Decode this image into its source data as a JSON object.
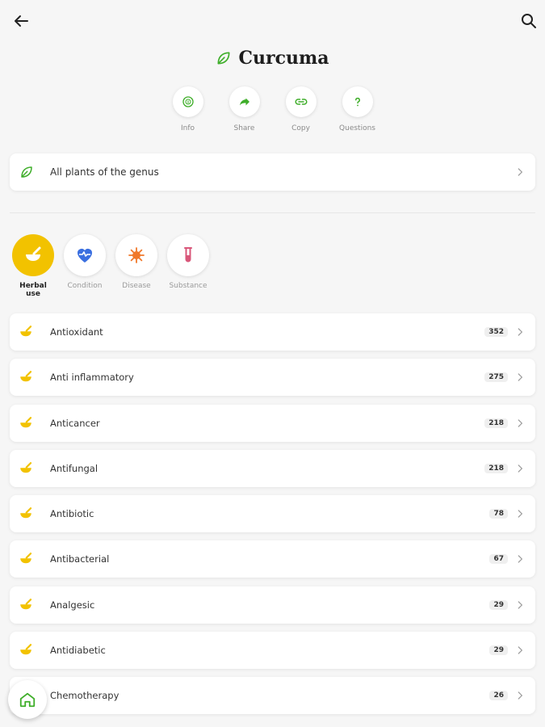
{
  "header": {
    "title": "Curcuma"
  },
  "actions": [
    {
      "label": "Info",
      "icon": "info-icon"
    },
    {
      "label": "Share",
      "icon": "share-icon"
    },
    {
      "label": "Copy",
      "icon": "link-icon"
    },
    {
      "label": "Questions",
      "icon": "question-icon"
    }
  ],
  "genus": {
    "label": "All plants of the genus"
  },
  "categories": [
    {
      "label": "Herbal use",
      "icon": "mortar-pestle-icon",
      "active": true
    },
    {
      "label": "Condition",
      "icon": "heart-pulse-icon",
      "active": false
    },
    {
      "label": "Disease",
      "icon": "virus-icon",
      "active": false
    },
    {
      "label": "Substance",
      "icon": "test-tube-icon",
      "active": false
    }
  ],
  "uses": [
    {
      "label": "Antioxidant",
      "count": "352"
    },
    {
      "label": "Anti inflammatory",
      "count": "275"
    },
    {
      "label": "Anticancer",
      "count": "218"
    },
    {
      "label": "Antifungal",
      "count": "218"
    },
    {
      "label": "Antibiotic",
      "count": "78"
    },
    {
      "label": "Antibacterial",
      "count": "67"
    },
    {
      "label": "Analgesic",
      "count": "29"
    },
    {
      "label": "Antidiabetic",
      "count": "29"
    },
    {
      "label": "Chemotherapy",
      "count": "26"
    }
  ],
  "colors": {
    "accent_green": "#3fae2a",
    "active_yellow": "#f2c200",
    "condition_blue": "#3a6fe0",
    "disease_orange": "#f0782a",
    "substance_pink": "#d9577a"
  }
}
